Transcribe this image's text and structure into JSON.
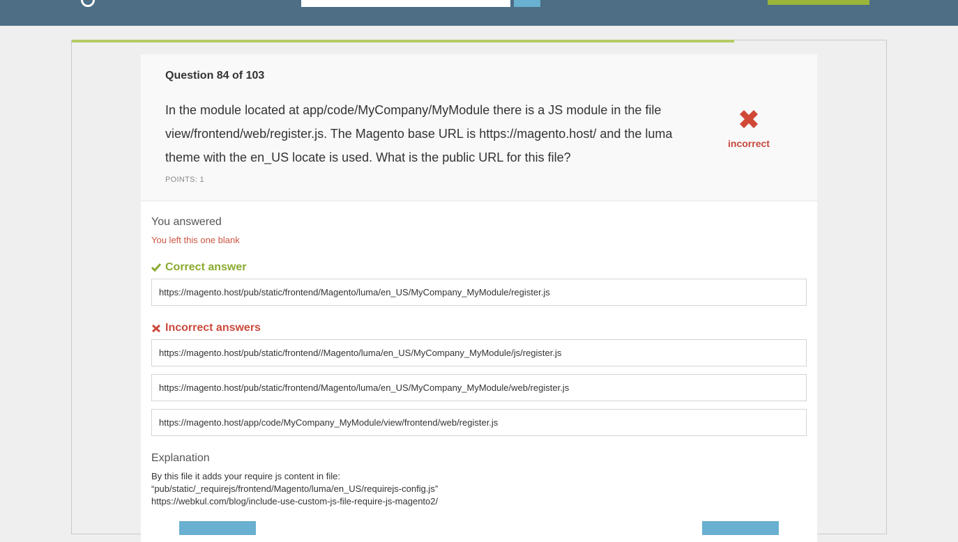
{
  "header": {
    "logo_icon": "logo-mark-icon",
    "search_icon": "search-icon"
  },
  "question": {
    "number_text": "Question 84 of 103",
    "text": "In the module located at app/code/MyCompany/MyModule there is a JS module in the file view/frontend/web/register.js. The Magento base URL is https://magento.host/ and the luma theme with the en_US locate is used. What is the public URL for this file?",
    "points": "POINTS: 1",
    "progress_fraction": 0.81
  },
  "result": {
    "icon": "x-icon",
    "label": "incorrect",
    "color": "#c7483b"
  },
  "answered": {
    "label": "You answered",
    "value": "You left this one blank"
  },
  "correct": {
    "title": "Correct answer",
    "icon": "check-icon",
    "color": "#8aaa2e",
    "answers": [
      "https://magento.host/pub/static/frontend/Magento/luma/en_US/MyCompany_MyModule/register.js"
    ]
  },
  "incorrect": {
    "title": "Incorrect answers",
    "icon": "x-small-icon",
    "color": "#cc4a3c",
    "answers": [
      "https://magento.host/pub/static/frontend//Magento/luma/en_US/MyCompany_MyModule/js/register.js",
      "https://magento.host/pub/static/frontend/Magento/luma/en_US/MyCompany_MyModule/web/register.js",
      "https://magento.host/app/code/MyCompany_MyModule/view/frontend/web/register.js"
    ]
  },
  "explanation": {
    "title": "Explanation",
    "lines": [
      "By this file it adds your require js content in file:",
      "“pub/static/_requirejs/frontend/Magento/luma/en_US/requirejs-config.js”",
      "https://webkul.com/blog/include-use-custom-js-file-require-js-magento2/"
    ]
  }
}
